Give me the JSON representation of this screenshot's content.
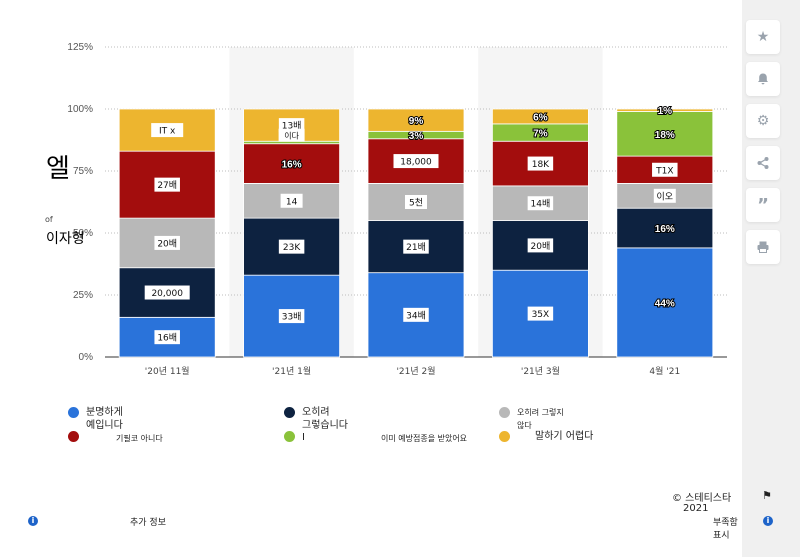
{
  "chart_data": {
    "type": "bar",
    "stacked": true,
    "ylabel_big": "엘",
    "ylabel_small": "of",
    "ylabel_mid": "이자형",
    "y_ticks": [
      "0%",
      "25%",
      "50%",
      "75%",
      "100%",
      "125%"
    ],
    "ylim": [
      0,
      125
    ],
    "grid": true,
    "categories": [
      "'20년 11월",
      "'21년 1월",
      "'21년 2월",
      "'21년 3월",
      "4월 '21"
    ],
    "series": [
      {
        "name": "분명하게 예입니다",
        "color": "#2a73da",
        "values": [
          16,
          33,
          34,
          35,
          44
        ],
        "labels": [
          "16배",
          "33배",
          "34배",
          "35X",
          "44%"
        ]
      },
      {
        "name": "오히려 그렇습니다",
        "color": "#0d2240",
        "values": [
          20,
          23,
          21,
          20,
          16
        ],
        "labels": [
          "20,000",
          "23K",
          "21배",
          "20배",
          "16%"
        ]
      },
      {
        "name": "오히려 그렇지 않다",
        "color": "#b8b8b8",
        "values": [
          20,
          14,
          15,
          14,
          10
        ],
        "labels": [
          "20배",
          "14",
          "5천",
          "14배",
          "이오"
        ]
      },
      {
        "name": "기필코 아니다",
        "color": "#a30d0d",
        "values": [
          27,
          16,
          18,
          18,
          11
        ],
        "labels": [
          "27배",
          "16%",
          "18,000",
          "18K",
          "T1X"
        ]
      },
      {
        "name": "I",
        "color": "#8ac23a",
        "values": [
          0,
          1,
          3,
          7,
          18
        ],
        "labels": [
          "",
          "",
          "3%",
          "7%",
          "18%"
        ]
      },
      {
        "name": "이미 예방접종을 받았어요",
        "color": "#edb52f",
        "values": [
          17,
          13,
          9,
          6,
          1
        ],
        "labels": [
          "IT x",
          "13배",
          "9%",
          "6%",
          "1%"
        ]
      }
    ],
    "extra_labels": [
      {
        "category_index": 1,
        "text": "이다"
      }
    ]
  },
  "legend": {
    "s0a": "분명하게",
    "s0b": "예입니다",
    "s1a": "오히려",
    "s1b": "그렇습니다",
    "s2a": "오히려 그렇지",
    "s2b": "않다",
    "s3": "기필코 아니다",
    "s4": "I",
    "s5a": "이미 예방접종을 받았어요",
    "s5b": "말하기 어렵다"
  },
  "footer": {
    "copyright_line1": "© 스테티스타",
    "copyright_line2": "2021",
    "more_info": "추가 정보",
    "flag_label": "부족함 표시"
  },
  "colors": {
    "accent": "#1d63c9"
  },
  "sidebar_icons": [
    "star-icon",
    "bell-icon",
    "gear-icon",
    "share-icon",
    "quote-icon",
    "print-icon"
  ]
}
